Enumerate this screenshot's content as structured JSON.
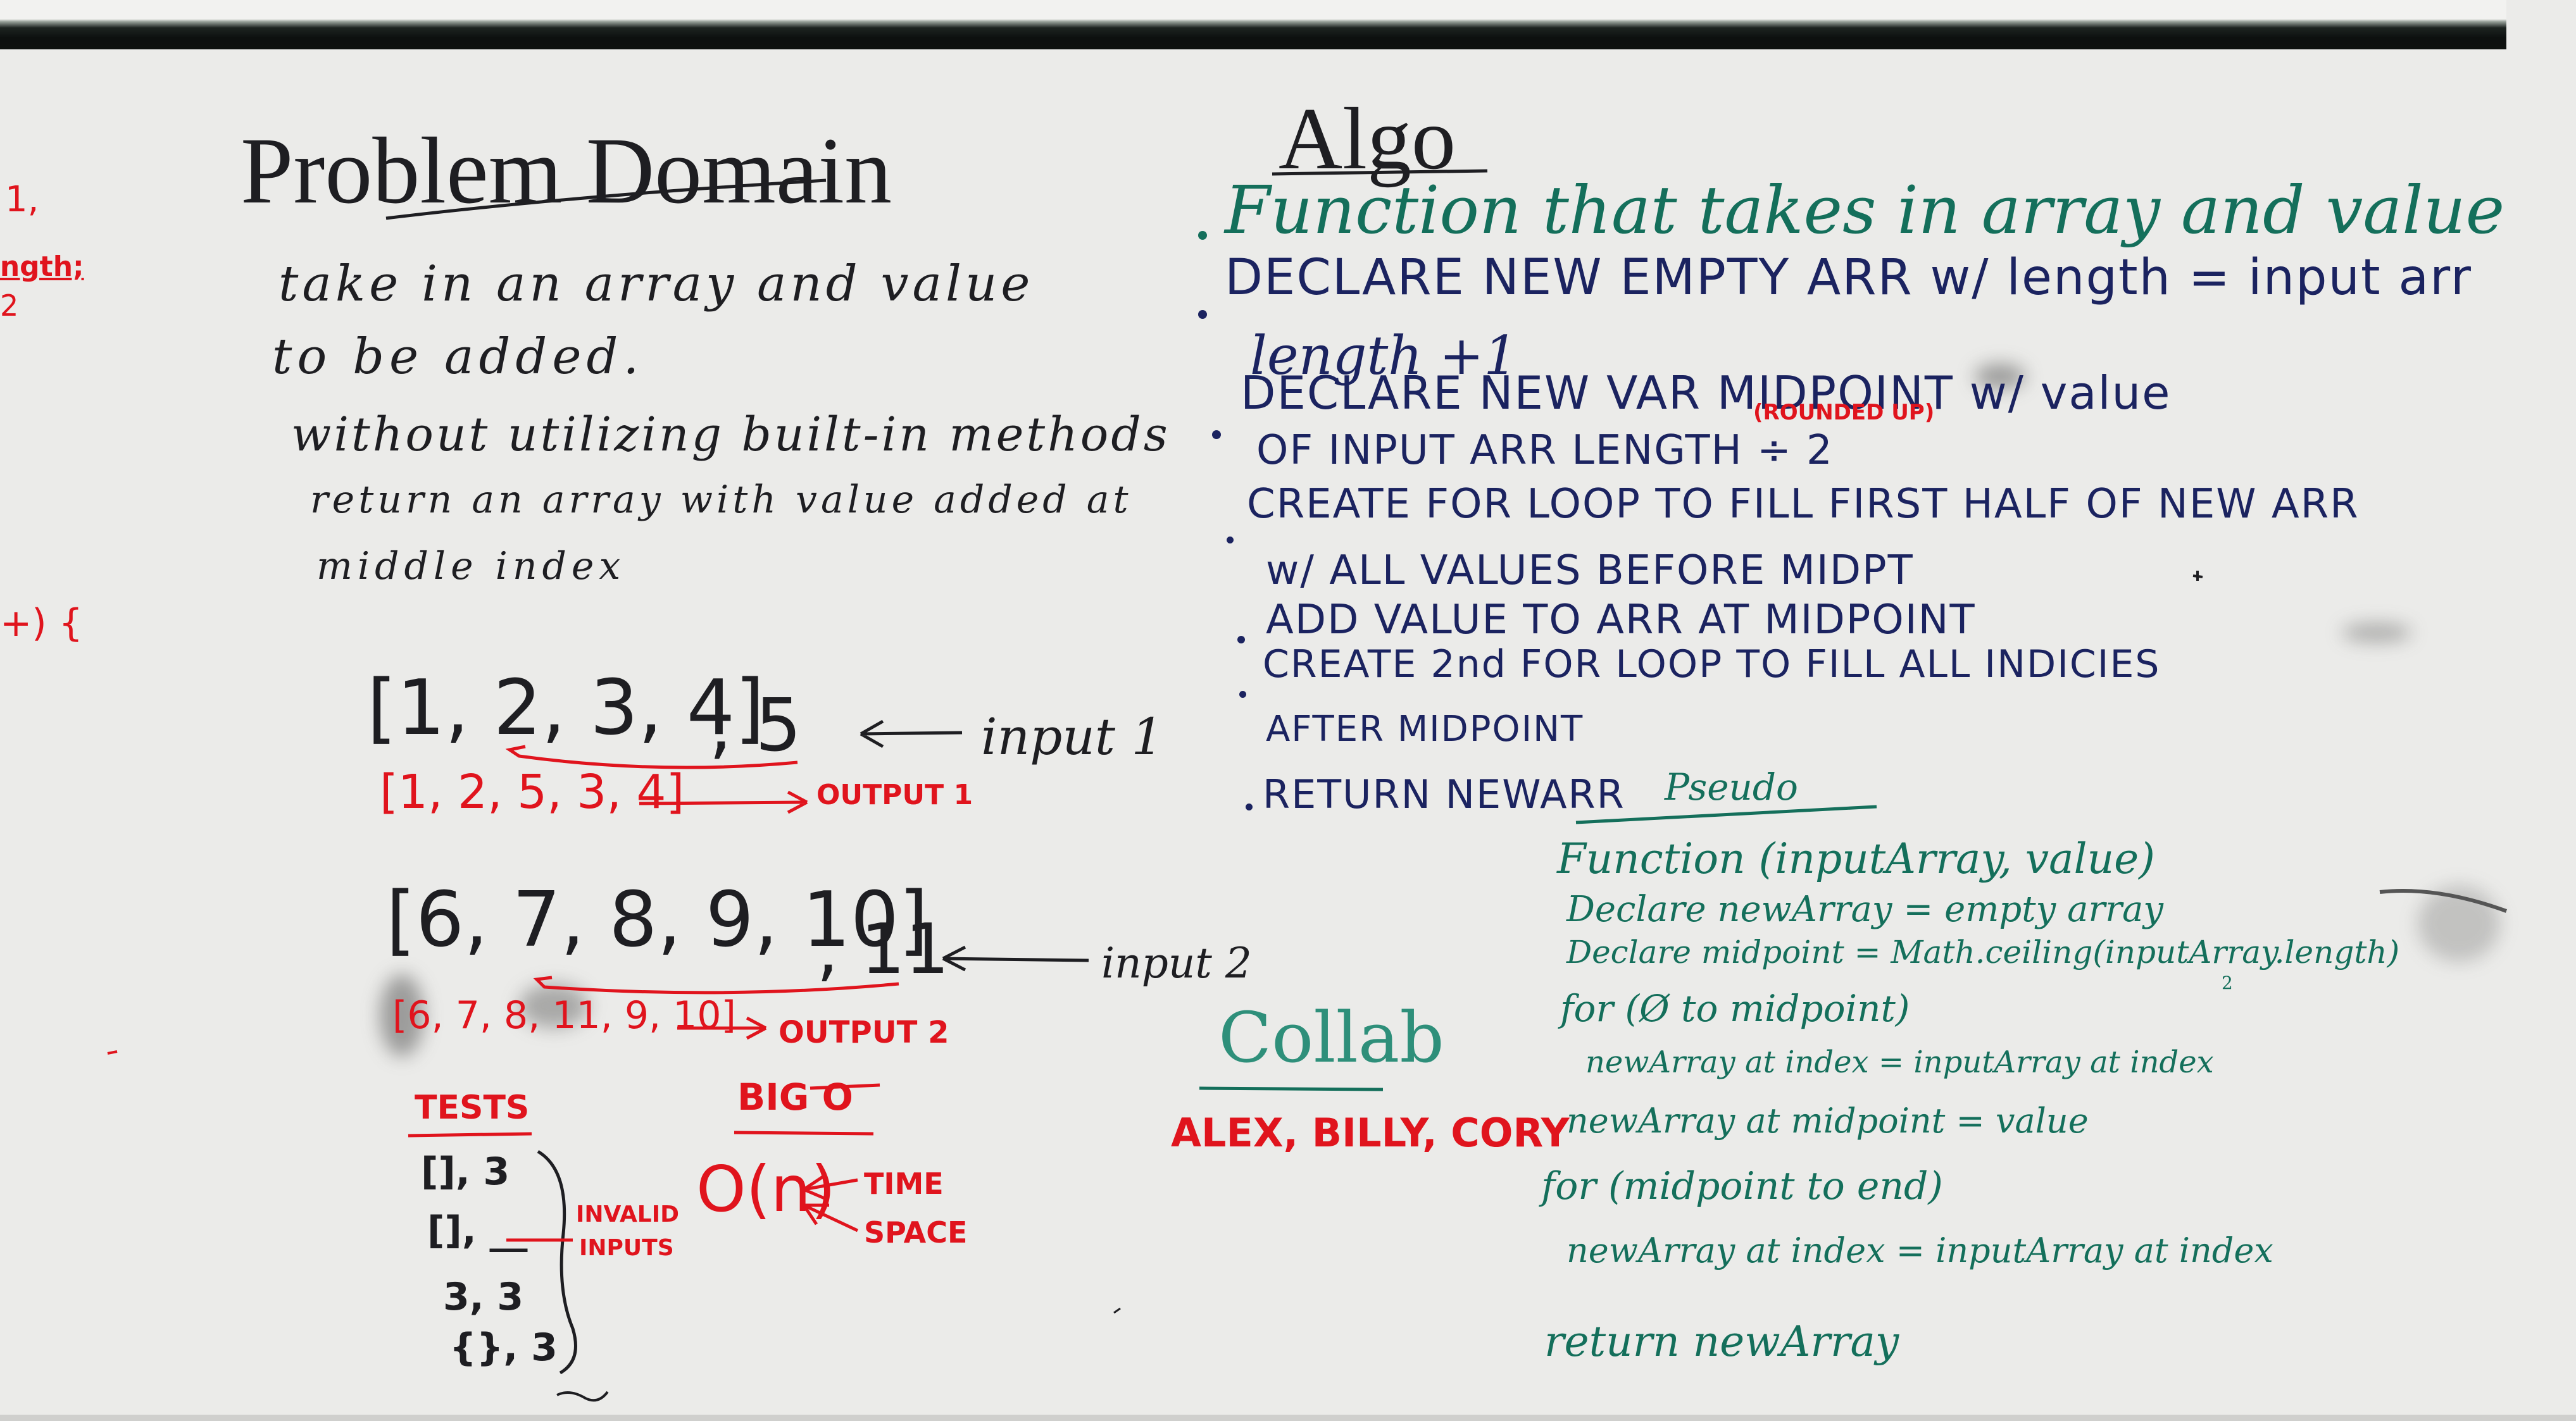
{
  "problem_domain": {
    "title": "Problem Domain",
    "lines": [
      "take in an array and value",
      "to be added.",
      "without utilizing built-in methods",
      "return an array with value added at",
      "middle index"
    ]
  },
  "examples": {
    "input1_array": "[1, 2, 3, 4]",
    "input1_value": ", 5",
    "input1_label": "input 1",
    "output1_array": "[1, 2, 5, 3, 4]",
    "output1_label": "OUTPUT 1",
    "input2_array": "[6, 7, 8, 9, 10]",
    "input2_value": ", 11",
    "input2_label": "input 2",
    "output2_array": "[6, 7, 8, 11, 9, 10]",
    "output2_label": "OUTPUT 2"
  },
  "tests": {
    "title": "TESTS",
    "items": [
      "[], 3",
      "[], __",
      "3, 3",
      "{}, 3"
    ],
    "invalid_label_1": "INVALID",
    "invalid_label_2": "INPUTS"
  },
  "big_o": {
    "title": "BIG O",
    "value": "O(n)",
    "time_label": "TIME",
    "space_label": "SPACE"
  },
  "algo": {
    "title": "Algo",
    "step1": "Function that takes in array and value",
    "step2_line1": "DECLARE NEW EMPTY ARR w/ length = input arr",
    "step2_line2": "length +1",
    "step3_line1": "DECLARE NEW VAR MIDPOINT w/ value",
    "step3_line2": "OF INPUT ARR LENGTH ÷ 2",
    "step3_note": "(ROUNDED UP)",
    "step4_line1": "CREATE FOR LOOP TO FILL FIRST HALF OF NEW ARR",
    "step4_line2": "w/ ALL VALUES BEFORE MIDPT",
    "step5": "ADD VALUE TO ARR AT MIDPOINT",
    "step6_line1": "CREATE 2nd FOR LOOP TO FILL ALL INDICIES",
    "step6_line2": "AFTER MIDPOINT",
    "step7": "RETURN NEWARR"
  },
  "pseudo": {
    "title": "Pseudo",
    "lines": [
      "Function (inputArray, value)",
      "Declare newArray = empty array",
      "Declare midpoint = Math.ceiling(inputArray.length)",
      "for (Ø to midpoint)",
      "newArray at index = inputArray at index",
      "newArray at midpoint = value",
      "for (midpoint to end)",
      "newArray at index = inputArray at index",
      "return newArray"
    ],
    "divisor": "2"
  },
  "collab": {
    "title": "Collab",
    "names": "ALEX, BILLY, CORY"
  },
  "left_edge": {
    "fragment1": "1,",
    "fragment2": "ength;",
    "fragment3": "2",
    "fragment4": "+) {"
  },
  "colors": {
    "board": "#ebebe9",
    "black_marker": "#1e1e22",
    "blue_marker": "#1b2360",
    "green_marker": "#146f5b",
    "red_marker": "#e0141d"
  }
}
